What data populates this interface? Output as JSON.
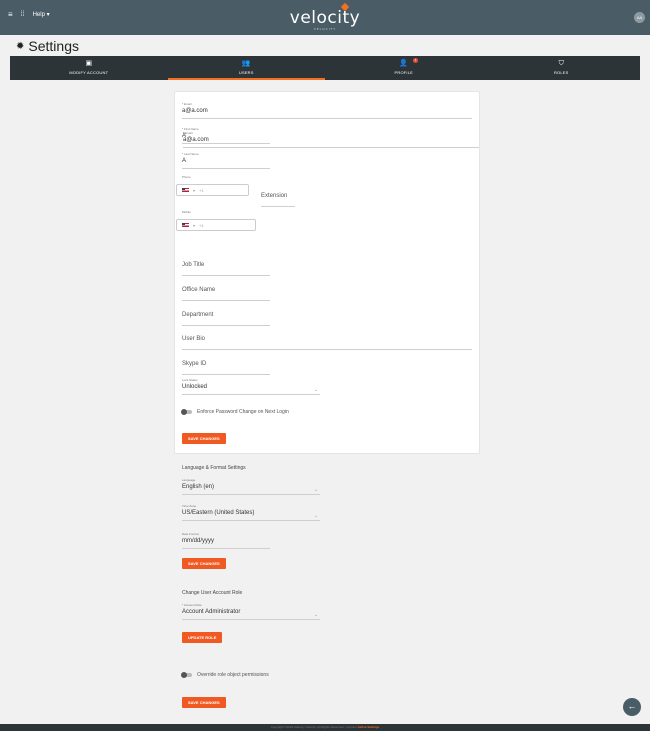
{
  "topbar": {
    "help": "Help ▾",
    "brand": "velocity",
    "brand_sub": "VELOCITY",
    "avatar": "AA"
  },
  "page_title": "Settings",
  "tabs": [
    {
      "label": "Modify Account"
    },
    {
      "label": "Users"
    },
    {
      "label": "Profile",
      "badge": "1"
    },
    {
      "label": "Roles"
    }
  ],
  "profile_form": {
    "email_label": "* Email",
    "email_value": "a@a.com",
    "first_name_label": "* First Name",
    "first_name_value": "A",
    "last_name_label": "* Last Name",
    "last_name_value": "A",
    "phone_label": "Phone",
    "phone_code": "+1",
    "extension_placeholder": "Extension",
    "mobile_label": "Mobile",
    "mobile_code": "+1",
    "job_title": "Job Title",
    "office_name": "Office Name",
    "department": "Department",
    "user_bio": "User Bio",
    "skype_id": "Skype ID",
    "lock_status_label": "Lock Status",
    "lock_status_value": "Unlocked",
    "enforce_password_label": "Enforce Password Change on Next Login",
    "save_label": "Save Changes"
  },
  "lang_form": {
    "title": "Language & Format Settings",
    "language_label": "Language",
    "language_value": "English (en)",
    "timezone_label": "Time Zone",
    "timezone_value": "US/Eastern (United States)",
    "date_format_label": "Date Format",
    "date_format_value": "mm/dd/yyyy",
    "save_label": "Save Changes"
  },
  "role_form": {
    "title": "Change User Account Role",
    "role_label": "* Account Role",
    "role_value": "Account Administrator",
    "update_label": "Update Role"
  },
  "perm_form": {
    "override_label": "Override role object permissions",
    "save_label": "Save Changes"
  },
  "footer": {
    "text": "Copyright ©2024 Atlas by Velocity. All Rights Reserved. | Version",
    "link": "Active Settings"
  },
  "colors": {
    "accent": "#f05a22",
    "topbar": "#4a5d66",
    "tabs": "#2c3438"
  }
}
